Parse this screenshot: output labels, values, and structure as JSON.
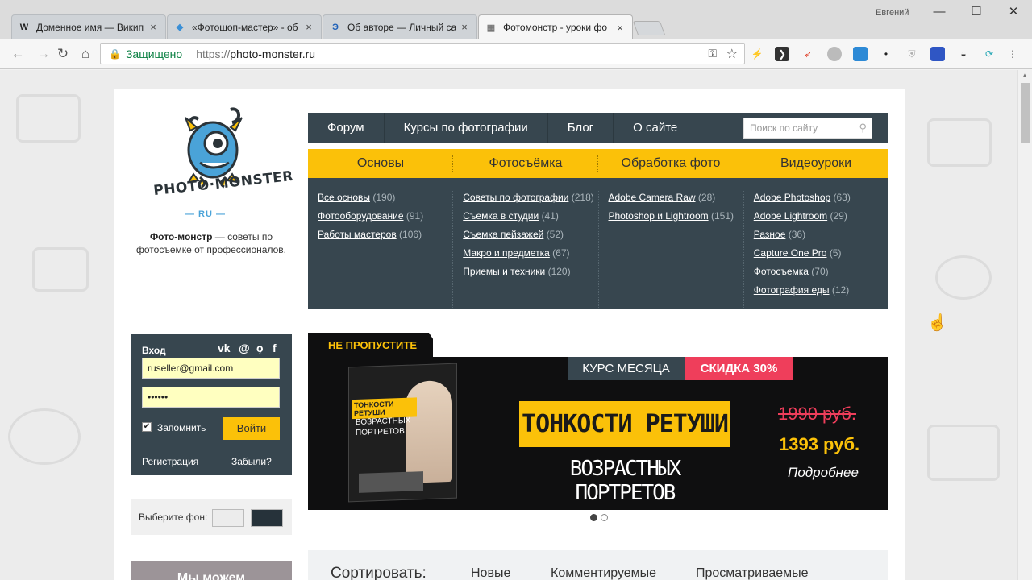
{
  "browser": {
    "tabs": [
      {
        "icon": "W",
        "title": "Доменное имя — Википедия",
        "close": "×"
      },
      {
        "icon": "◆",
        "title": "«Фотошоп-мастер» - об",
        "close": "×"
      },
      {
        "icon": "Э",
        "title": "Об авторе — Личный са",
        "close": "×"
      },
      {
        "icon": "▦",
        "title": "Фотомонстр - уроки фо",
        "close": "×"
      }
    ],
    "user": "Евгений",
    "window_controls": [
      "—",
      "☐",
      "✕"
    ],
    "url_secure_label": "Защищено",
    "url_proto": "https://",
    "url_host": "photo-monster.ru"
  },
  "site": {
    "logo_text": "PHOTO·MONSTER",
    "logo_ru": "— RU —",
    "tagline_bold": "Фото-монстр",
    "tagline_rest": " — советы по фотосъемке от профессионалов."
  },
  "topnav": {
    "items": [
      "Форум",
      "Курсы по фотографии",
      "Блог",
      "О сайте"
    ],
    "search_placeholder": "Поиск по сайту"
  },
  "categories": [
    {
      "title": "Основы",
      "links": [
        {
          "label": "Все основы",
          "count": "(190)"
        },
        {
          "label": "Фотооборудование",
          "count": "(91)"
        },
        {
          "label": "Работы мастеров",
          "count": "(106)"
        }
      ]
    },
    {
      "title": "Фотосъёмка",
      "links": [
        {
          "label": "Советы по фотографии",
          "count": "(218)"
        },
        {
          "label": "Съемка в студии",
          "count": "(41)"
        },
        {
          "label": "Съемка пейзажей",
          "count": "(52)"
        },
        {
          "label": "Макро и предметка",
          "count": "(67)"
        },
        {
          "label": "Приемы и техники",
          "count": "(120)"
        }
      ]
    },
    {
      "title": "Обработка фото",
      "links": [
        {
          "label": "Adobe Camera Raw",
          "count": "(28)"
        },
        {
          "label": "Photoshop и Lightroom",
          "count": "(151)"
        }
      ]
    },
    {
      "title": "Видеоуроки",
      "links": [
        {
          "label": "Adobe Photoshop",
          "count": "(63)"
        },
        {
          "label": "Adobe Lightroom",
          "count": "(29)"
        },
        {
          "label": "Разное",
          "count": "(36)"
        },
        {
          "label": "Capture One Pro",
          "count": "(5)"
        },
        {
          "label": "Фотосъемка",
          "count": "(70)"
        },
        {
          "label": "Фотография еды",
          "count": "(12)"
        }
      ]
    }
  ],
  "login": {
    "title": "Вход",
    "social": [
      "vk",
      "@",
      "ok",
      "f"
    ],
    "email": "ruseller@gmail.com",
    "password": "••••••",
    "remember": "Запомнить",
    "submit": "Войти",
    "register": "Регистрация",
    "forgot": "Забыли?"
  },
  "bgpicker": {
    "label": "Выберите фон:"
  },
  "promo2": {
    "text": "Мы можем"
  },
  "banner": {
    "ribbon": "НЕ ПРОПУСТИТЕ",
    "course_badge": "КУРС МЕСЯЦА",
    "discount": "СКИДКА 30%",
    "book_title": "ТОНКОСТИ РЕТУШИ",
    "book_sub": "ВОЗРАСТНЫХ ПОРТРЕТОВ",
    "headline": "ТОНКОСТИ РЕТУШИ",
    "subline": "ВОЗРАСТНЫХ ПОРТРЕТОВ",
    "old_price": "1990 руб.",
    "new_price": "1393 руб.",
    "more": "Подробнее"
  },
  "sort": {
    "label": "Сортировать:",
    "options": [
      "Новые",
      "Комментируемые",
      "Просматриваемые"
    ]
  },
  "colors": {
    "accent": "#fbc109",
    "nav": "#37464f",
    "sale": "#ef3e5b"
  }
}
